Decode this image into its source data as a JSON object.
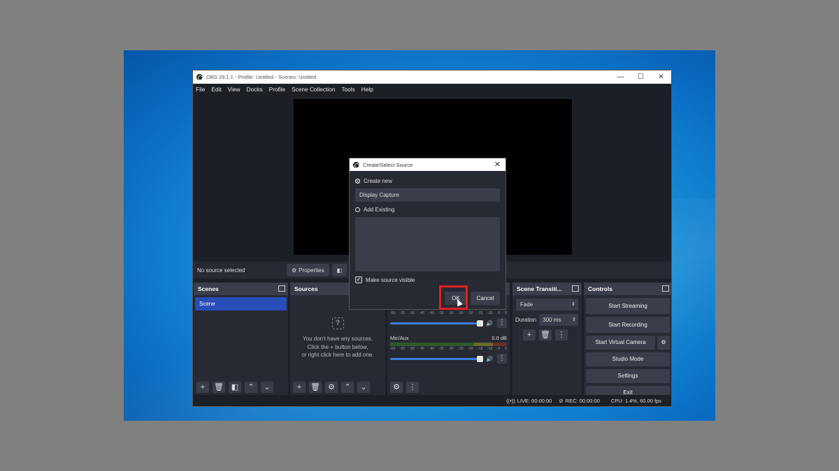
{
  "window": {
    "title": "OBS 29.1.1 - Profile: Untitled - Scenes: Untitled",
    "controls": [
      "—",
      "☐",
      "✕"
    ]
  },
  "menu": [
    "File",
    "Edit",
    "View",
    "Docks",
    "Profile",
    "Scene Collection",
    "Tools",
    "Help"
  ],
  "source_toolbar": {
    "status": "No source selected",
    "properties_label": "Properties"
  },
  "docks": {
    "scenes": {
      "title": "Scenes",
      "items": [
        "Scene"
      ]
    },
    "sources": {
      "title": "Sources",
      "empty_lines": [
        "You don't have any sources.",
        "Click the + button below,",
        "or right click here to add one."
      ]
    },
    "mixer": {
      "ticks": [
        "-60",
        "-55",
        "-50",
        "-45",
        "-40",
        "-35",
        "-30",
        "-25",
        "-20",
        "-15",
        "-10",
        "-5",
        "0"
      ],
      "channel2_name": "Mic/Aux",
      "channel2_db": "0.0 dB"
    },
    "transitions": {
      "title": "Scene Transiti...",
      "type": "Fade",
      "duration_label": "Duration",
      "duration_value": "300 ms"
    },
    "controls": {
      "title": "Controls",
      "start_streaming": "Start Streaming",
      "start_recording": "Start Recording",
      "start_virtual_camera": "Start Virtual Camera",
      "studio_mode": "Studio Mode",
      "settings": "Settings",
      "exit": "Exit"
    }
  },
  "status": {
    "live": "LIVE: 00:00:00",
    "rec": "REC: 00:00:00",
    "cpu": "CPU: 1.4%, 60.00 fps"
  },
  "dialog": {
    "title": "Create/Select Source",
    "create_new_label": "Create new",
    "name_value": "Display Capture",
    "add_existing_label": "Add Existing",
    "make_visible_label": "Make source visible",
    "ok_label": "OK",
    "cancel_label": "Cancel"
  },
  "colors": {
    "highlight": "#e02020",
    "selection": "#284cb8"
  }
}
